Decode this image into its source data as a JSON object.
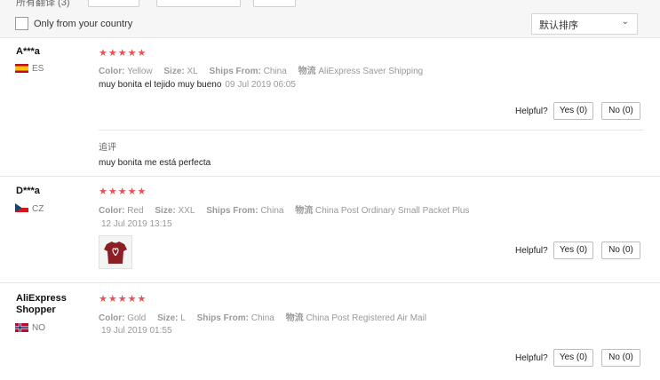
{
  "top": {
    "label": "所有翻译 (3)",
    "filter_countries": "Only from your country",
    "sort_label": "默认排序"
  },
  "reviews": [
    {
      "name": "A***a",
      "country": "ES",
      "stars": "★★★★★",
      "color_label": "Color:",
      "color": "Yellow",
      "size_label": "Size:",
      "size": "XL",
      "ships_label": "Ships From:",
      "ships": "China",
      "logistics_label": "物流",
      "logistics": "AliExpress Saver Shipping",
      "text": "muy bonita el tejido muy bueno",
      "date": "09 Jul 2019 06:05",
      "helpful": "Helpful?",
      "yes": "Yes (0)",
      "no": "No (0)",
      "append_label": "追评",
      "append_text": "muy bonita me está perfecta"
    },
    {
      "name": "D***a",
      "country": "CZ",
      "stars": "★★★★★",
      "color_label": "Color:",
      "color": "Red",
      "size_label": "Size:",
      "size": "XXL",
      "ships_label": "Ships From:",
      "ships": "China",
      "logistics_label": "物流",
      "logistics": "China Post Ordinary Small Packet Plus",
      "date": "12 Jul 2019 13:15",
      "helpful": "Helpful?",
      "yes": "Yes (0)",
      "no": "No (0)"
    },
    {
      "name": "AliExpress Shopper",
      "country": "NO",
      "stars": "★★★★★",
      "color_label": "Color:",
      "color": "Gold",
      "size_label": "Size:",
      "size": "L",
      "ships_label": "Ships From:",
      "ships": "China",
      "logistics_label": "物流",
      "logistics": "China Post Registered Air Mail",
      "date": "19 Jul 2019 01:55",
      "helpful": "Helpful?",
      "yes": "Yes (0)",
      "no": "No (0)"
    }
  ],
  "colors": {
    "star": "#e85257",
    "border": "#e7e7e7"
  }
}
